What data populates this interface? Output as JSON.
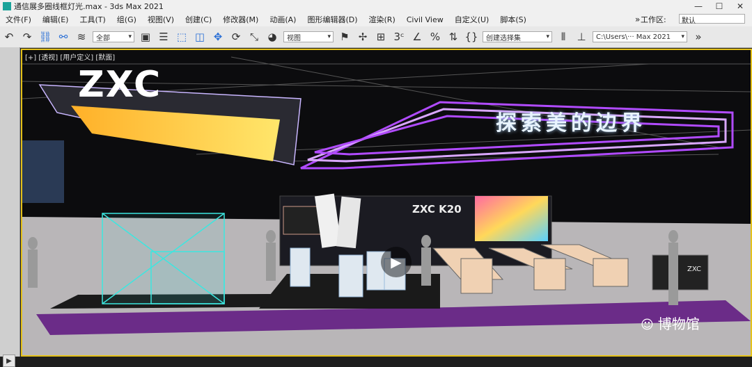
{
  "app": {
    "title": "通信展多圈线框灯光.max - 3ds Max 2021",
    "window_controls": {
      "minimize": "—",
      "maximize": "☐",
      "close": "✕"
    }
  },
  "menu": {
    "items": [
      "文件(F)",
      "编辑(E)",
      "工具(T)",
      "组(G)",
      "视图(V)",
      "创建(C)",
      "修改器(M)",
      "动画(A)",
      "图形编辑器(D)",
      "渲染(R)",
      "Civil View",
      "自定义(U)",
      "脚本(S)"
    ],
    "workspace_label": "工作区:",
    "workspace_value": "默认"
  },
  "toolbar": {
    "selection_filter": "全部",
    "coord_system": "视图",
    "named_selection": "创建选择集",
    "project_path": "C:\\Users\\··· Max 2021"
  },
  "viewport": {
    "label": "[+] [透视] [用户定义] [默面]",
    "brand_logo": "ZXC",
    "banner_text": "探索美的边界",
    "screen_brand": "ZXC K20",
    "counter_brand": "ZXC"
  },
  "overlay": {
    "watermark": "博物馆"
  },
  "colors": {
    "selection_border": "#e5c21a",
    "neon_purple": "#b14bff",
    "neon_cyan": "#3ce7e0",
    "viewport_bg": "#0c0c0e"
  }
}
